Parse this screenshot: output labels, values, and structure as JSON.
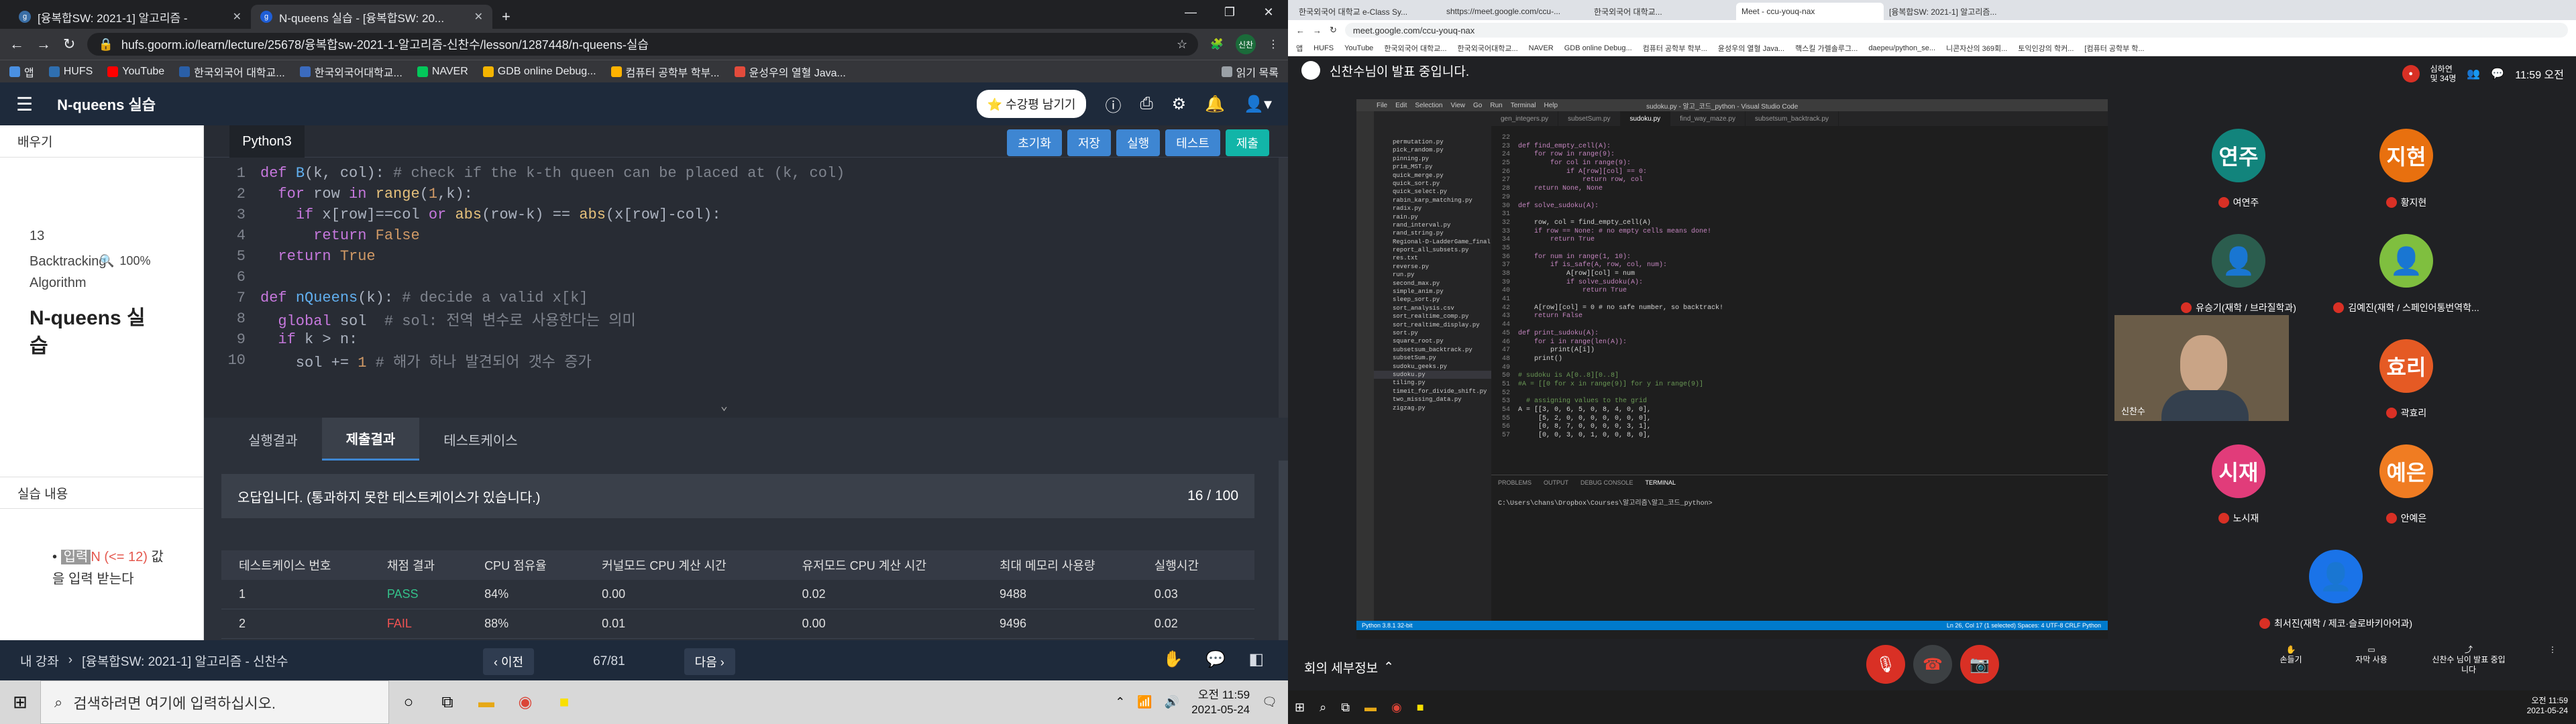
{
  "left": {
    "tabs": [
      {
        "label": "[융복합SW: 2021-1] 알고리즘 -",
        "active": false,
        "fav_color": "#3a6ea5"
      },
      {
        "label": "N-queens 실습 - [융복합SW: 20...",
        "active": true,
        "fav_color": "#1f5ed6"
      }
    ],
    "window": {
      "min": "—",
      "max": "❐",
      "close": "✕"
    },
    "url": "hufs.goorm.io/learn/lecture/25678/융복합sw-2021-1-알고리즘-신찬수/lesson/1287448/n-queens-실습",
    "profile": "신찬",
    "bookmarks": [
      {
        "label": "앱",
        "color": "#4a90e2"
      },
      {
        "label": "HUFS",
        "color": "#2f6fb0"
      },
      {
        "label": "YouTube",
        "color": "#ff0000"
      },
      {
        "label": "한국외국어 대학교...",
        "color": "#2a5fa8"
      },
      {
        "label": "한국외국어대학교...",
        "color": "#3b6bbf"
      },
      {
        "label": "NAVER",
        "color": "#03c75a"
      },
      {
        "label": "GDB online Debug...",
        "color": "#f4b400"
      },
      {
        "label": "컴퓨터 공학부 학부...",
        "color": "#ffb300"
      },
      {
        "label": "윤성우의 열혈 Java...",
        "color": "#e34b3c"
      },
      {
        "label": "읽기 목록",
        "color": "#9aa0a6"
      }
    ],
    "header": {
      "title": "N-queens 실습",
      "feedback": "⭐ 수강평 남기기"
    },
    "sidebar": {
      "learn_label": "배우기",
      "lesson_num": "13",
      "category": "Backtracking Algorithm",
      "zoom": "100%",
      "lesson_title": "N-queens 실습",
      "content_label": "실습 내용",
      "content_hl": "입력",
      "content_red": "N (<= 12)",
      "content_rest": "값을 입력 받는다"
    },
    "editor": {
      "language": "Python3",
      "buttons": [
        "초기화",
        "저장",
        "실행",
        "테스트",
        "제출"
      ],
      "lines": [
        {
          "n": "1",
          "html": "<span class='kw'>def</span> <span class='fn'>B</span>(k, col): <span class='cm'># check if the k-th queen can be placed at (k, col)</span>"
        },
        {
          "n": "2",
          "html": "  <span class='kw'>for</span> row <span class='kw'>in</span> <span class='bi'>range</span>(<span class='num'>1</span>,k):"
        },
        {
          "n": "3",
          "html": "    <span class='kw'>if</span> x[row]==col <span class='kw'>or</span> <span class='bi'>abs</span>(row-k) == <span class='bi'>abs</span>(x[row]-col):"
        },
        {
          "n": "4",
          "html": "      <span class='kw'>return</span> <span class='num'>False</span>"
        },
        {
          "n": "5",
          "html": "  <span class='kw'>return</span> <span class='num'>True</span>"
        },
        {
          "n": "6",
          "html": ""
        },
        {
          "n": "7",
          "html": "<span class='kw'>def</span> <span class='fn'>nQueens</span>(k): <span class='cm'># decide a valid x[k]</span>"
        },
        {
          "n": "8",
          "html": "  <span class='kw'>global</span> sol  <span class='cm'># sol: 전역 변수로 사용한다는 의미</span>"
        },
        {
          "n": "9",
          "html": "  <span class='kw'>if</span> k > n:"
        },
        {
          "n": "10",
          "html": "    sol += <span class='num'>1</span> <span class='cm'># 해가 하나 발견되어 갯수 증가</span>"
        }
      ]
    },
    "result_tabs": [
      "실행결과",
      "제출결과",
      "테스트케이스"
    ],
    "result": {
      "message": "오답입니다. (통과하지 못한 테스트케이스가 있습니다.)",
      "score": "16 / 100",
      "columns": [
        "테스트케이스 번호",
        "채점 결과",
        "CPU 점유율",
        "커널모드 CPU 계산 시간",
        "유저모드 CPU 계산 시간",
        "최대 메모리 사용량",
        "실행시간"
      ],
      "rows": [
        {
          "no": "1",
          "status": "PASS",
          "cpu": "84%",
          "kernel": "0.00",
          "user": "0.02",
          "mem": "9488",
          "time": "0.03"
        },
        {
          "no": "2",
          "status": "FAIL",
          "cpu": "88%",
          "kernel": "0.01",
          "user": "0.00",
          "mem": "9496",
          "time": "0.02"
        }
      ]
    },
    "bottom": {
      "breadcrumb_home": "내 강좌",
      "breadcrumb_course": "[융복합SW: 2021-1] 알고리즘 - 신찬수",
      "prev": "‹ 이전",
      "page": "67/81",
      "next": "다음 ›"
    },
    "taskbar": {
      "search_placeholder": "검색하려면 여기에 입력하십시오.",
      "time": "오전 11:59",
      "date": "2021-05-24"
    }
  },
  "right": {
    "tabs": [
      "한국외국어 대학교 e-Class Sy...",
      "shttps://meet.google.com/ccu-...",
      "한국외국어 대학교...",
      "Meet - ccu-youq-nax",
      "[융복합SW: 2021-1] 알고리즘..."
    ],
    "url": "meet.google.com/ccu-youq-nax",
    "bookmarks": [
      "앱",
      "HUFS",
      "YouTube",
      "한국외국어 대학교...",
      "한국외국어대학교...",
      "NAVER",
      "GDB online Debug...",
      "컴퓨터 공학부 학부...",
      "윤성우의 열혈 Java...",
      "핵스킬 가렐솔루그...",
      "daepeu/python_se...",
      "니콘자산의 369회...",
      "토익인강의 학커...",
      "[컴퓨터 공학부 학..."
    ],
    "presenting": "신찬수님이 발표 중입니다.",
    "attendee_label": "심하연",
    "attendee_sub": "및 34명",
    "meet_time": "11:59 오전",
    "vscode": {
      "title": "sudoku.py - 알고_코드_python - Visual Studio Code",
      "menu": [
        "File",
        "Edit",
        "Selection",
        "View",
        "Go",
        "Run",
        "Terminal",
        "Help"
      ],
      "tabs": [
        "gen_integers.py",
        "subsetSum.py",
        "sudoku.py",
        "find_way_maze.py",
        "subsetsum_backtrack.py"
      ],
      "files": [
        "permutation.py",
        "pick_random.py",
        "pinning.py",
        "prim_MST.py",
        "quick_merge.py",
        "quick_sort.py",
        "quick_select.py",
        "rabin_karp_matching.py",
        "radix.py",
        "rain.py",
        "rand_interval.py",
        "rand_string.py",
        "Regional-D-LadderGame_final.pdf",
        "report_all_subsets.py",
        "res.txt",
        "reverse.py",
        "run.py",
        "second_max.py",
        "simple_anim.py",
        "sleep_sort.py",
        "sort_analysis.csv",
        "sort_realtime_comp.py",
        "sort_realtime_display.py",
        "sort.py",
        "square_root.py",
        "subsetsum_backtrack.py",
        "subsetSum.py",
        "sudoku_geeks.py",
        "sudoku.py",
        "tiling.py",
        "timeit_for_divide_shift.py",
        "two_missing_data.py",
        "zigzag.py"
      ],
      "code": [
        {
          "n": "22",
          "t": ""
        },
        {
          "n": "23",
          "t": "def find_empty_cell(A):"
        },
        {
          "n": "24",
          "t": "    for row in range(9):"
        },
        {
          "n": "25",
          "t": "        for col in range(9):"
        },
        {
          "n": "26",
          "t": "            if A[row][col] == 0:"
        },
        {
          "n": "27",
          "t": "                return row, col"
        },
        {
          "n": "28",
          "t": "    return None, None"
        },
        {
          "n": "29",
          "t": ""
        },
        {
          "n": "30",
          "t": "def solve_sudoku(A):"
        },
        {
          "n": "31",
          "t": ""
        },
        {
          "n": "32",
          "t": "    row, col = find_empty_cell(A)"
        },
        {
          "n": "33",
          "t": "    if row == None: # no empty cells means done!"
        },
        {
          "n": "34",
          "t": "        return True"
        },
        {
          "n": "35",
          "t": ""
        },
        {
          "n": "36",
          "t": "    for num in range(1, 10):"
        },
        {
          "n": "37",
          "t": "        if is_safe(A, row, col, num):"
        },
        {
          "n": "38",
          "t": "            A[row][col] = num"
        },
        {
          "n": "39",
          "t": "            if solve_sudoku(A):"
        },
        {
          "n": "40",
          "t": "                return True"
        },
        {
          "n": "41",
          "t": ""
        },
        {
          "n": "42",
          "t": "    A[row][col] = 0 # no safe number, so backtrack!"
        },
        {
          "n": "43",
          "t": "    return False"
        },
        {
          "n": "44",
          "t": ""
        },
        {
          "n": "45",
          "t": "def print_sudoku(A):"
        },
        {
          "n": "46",
          "t": "    for i in range(len(A)):"
        },
        {
          "n": "47",
          "t": "        print(A[i])"
        },
        {
          "n": "48",
          "t": "    print()"
        },
        {
          "n": "49",
          "t": ""
        },
        {
          "n": "50",
          "t": "# sudoku is A[0..8][0..8]"
        },
        {
          "n": "51",
          "t": "#A = [[0 for x in range(9)] for y in range(9)]"
        },
        {
          "n": "52",
          "t": ""
        },
        {
          "n": "53",
          "t": "  # assigning values to the grid"
        },
        {
          "n": "54",
          "t": "A = [[3, 0, 6, 5, 0, 8, 4, 0, 0],"
        },
        {
          "n": "55",
          "t": "     [5, 2, 0, 0, 0, 0, 0, 0, 0],"
        },
        {
          "n": "56",
          "t": "     [0, 8, 7, 0, 0, 0, 0, 3, 1],"
        },
        {
          "n": "57",
          "t": "     [0, 0, 3, 0, 1, 0, 0, 8, 0],"
        }
      ],
      "term_tabs": [
        "PROBLEMS",
        "OUTPUT",
        "DEBUG CONSOLE",
        "TERMINAL"
      ],
      "terminal_line": "C:\\Users\\chans\\Dropbox\\Courses\\알고리즘\\알고_코드_python>",
      "status": "Python 3.8.1 32-bit",
      "status_right": "Ln 26, Col 17 (1 selected)  Spaces: 4  UTF-8  CRLF  Python"
    },
    "participants": [
      {
        "initial": "연주",
        "name": "여연주",
        "color": "#12847c"
      },
      {
        "initial": "지현",
        "name": "황지현",
        "color": "#e8700f"
      },
      {
        "initial": "",
        "name": "유승기(재학 / 브라질학과)",
        "color": "#2b5d4e"
      },
      {
        "initial": "",
        "name": "김예진(재학 / 스페인어통번역학...",
        "color": "#7fbf3f"
      },
      {
        "initial": "효리",
        "name": "곽효리",
        "color": "#e55a24"
      },
      {
        "initial": "시재",
        "name": "노시재",
        "color": "#e13c7a"
      },
      {
        "initial": "예은",
        "name": "안예은",
        "color": "#f07c22"
      },
      {
        "initial": "",
        "name": "최서진(재학 / 제코·슬로바키아어과)",
        "color": "#1a73e8"
      }
    ],
    "self_name": "신찬수",
    "meeting_details": "회의 세부정보",
    "actions": [
      "손들기",
      "자막 사용",
      "신찬수 님이 발표 중입니다"
    ],
    "clock_time": "오전 11:59",
    "clock_date": "2021-05-24"
  }
}
